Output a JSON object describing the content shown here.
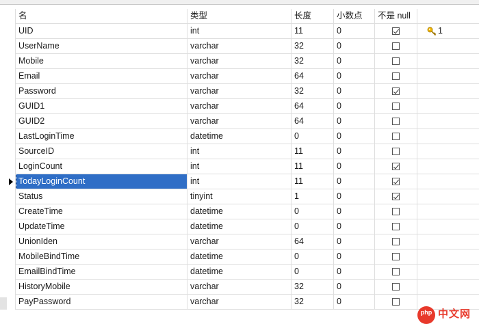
{
  "tabs": [
    "",
    "",
    "",
    "",
    "",
    "",
    ""
  ],
  "columns": {
    "name": "名",
    "type": "类型",
    "length": "长度",
    "decimals": "小数点",
    "not_null": "不是 null",
    "key": ""
  },
  "rows": [
    {
      "name": "UID",
      "type": "int",
      "length": "11",
      "decimals": "0",
      "not_null": true,
      "key": "1"
    },
    {
      "name": "UserName",
      "type": "varchar",
      "length": "32",
      "decimals": "0",
      "not_null": false,
      "key": ""
    },
    {
      "name": "Mobile",
      "type": "varchar",
      "length": "32",
      "decimals": "0",
      "not_null": false,
      "key": ""
    },
    {
      "name": "Email",
      "type": "varchar",
      "length": "64",
      "decimals": "0",
      "not_null": false,
      "key": ""
    },
    {
      "name": "Password",
      "type": "varchar",
      "length": "32",
      "decimals": "0",
      "not_null": true,
      "key": ""
    },
    {
      "name": "GUID1",
      "type": "varchar",
      "length": "64",
      "decimals": "0",
      "not_null": false,
      "key": ""
    },
    {
      "name": "GUID2",
      "type": "varchar",
      "length": "64",
      "decimals": "0",
      "not_null": false,
      "key": ""
    },
    {
      "name": "LastLoginTime",
      "type": "datetime",
      "length": "0",
      "decimals": "0",
      "not_null": false,
      "key": ""
    },
    {
      "name": "SourceID",
      "type": "int",
      "length": "11",
      "decimals": "0",
      "not_null": false,
      "key": ""
    },
    {
      "name": "LoginCount",
      "type": "int",
      "length": "11",
      "decimals": "0",
      "not_null": true,
      "key": ""
    },
    {
      "name": "TodayLoginCount",
      "type": "int",
      "length": "11",
      "decimals": "0",
      "not_null": true,
      "key": ""
    },
    {
      "name": "Status",
      "type": "tinyint",
      "length": "1",
      "decimals": "0",
      "not_null": true,
      "key": ""
    },
    {
      "name": "CreateTime",
      "type": "datetime",
      "length": "0",
      "decimals": "0",
      "not_null": false,
      "key": ""
    },
    {
      "name": "UpdateTime",
      "type": "datetime",
      "length": "0",
      "decimals": "0",
      "not_null": false,
      "key": ""
    },
    {
      "name": "UnionIden",
      "type": "varchar",
      "length": "64",
      "decimals": "0",
      "not_null": false,
      "key": ""
    },
    {
      "name": "MobileBindTime",
      "type": "datetime",
      "length": "0",
      "decimals": "0",
      "not_null": false,
      "key": ""
    },
    {
      "name": "EmailBindTime",
      "type": "datetime",
      "length": "0",
      "decimals": "0",
      "not_null": false,
      "key": ""
    },
    {
      "name": "HistoryMobile",
      "type": "varchar",
      "length": "32",
      "decimals": "0",
      "not_null": false,
      "key": ""
    },
    {
      "name": "PayPassword",
      "type": "varchar",
      "length": "32",
      "decimals": "0",
      "not_null": false,
      "key": ""
    }
  ],
  "selected_row": 10,
  "watermark": {
    "badge": "php",
    "text": "中文网"
  },
  "colors": {
    "selection": "#2f6ec6",
    "grid_line": "#dedede",
    "key_icon": "#f0b400",
    "watermark": "#e8392b"
  }
}
